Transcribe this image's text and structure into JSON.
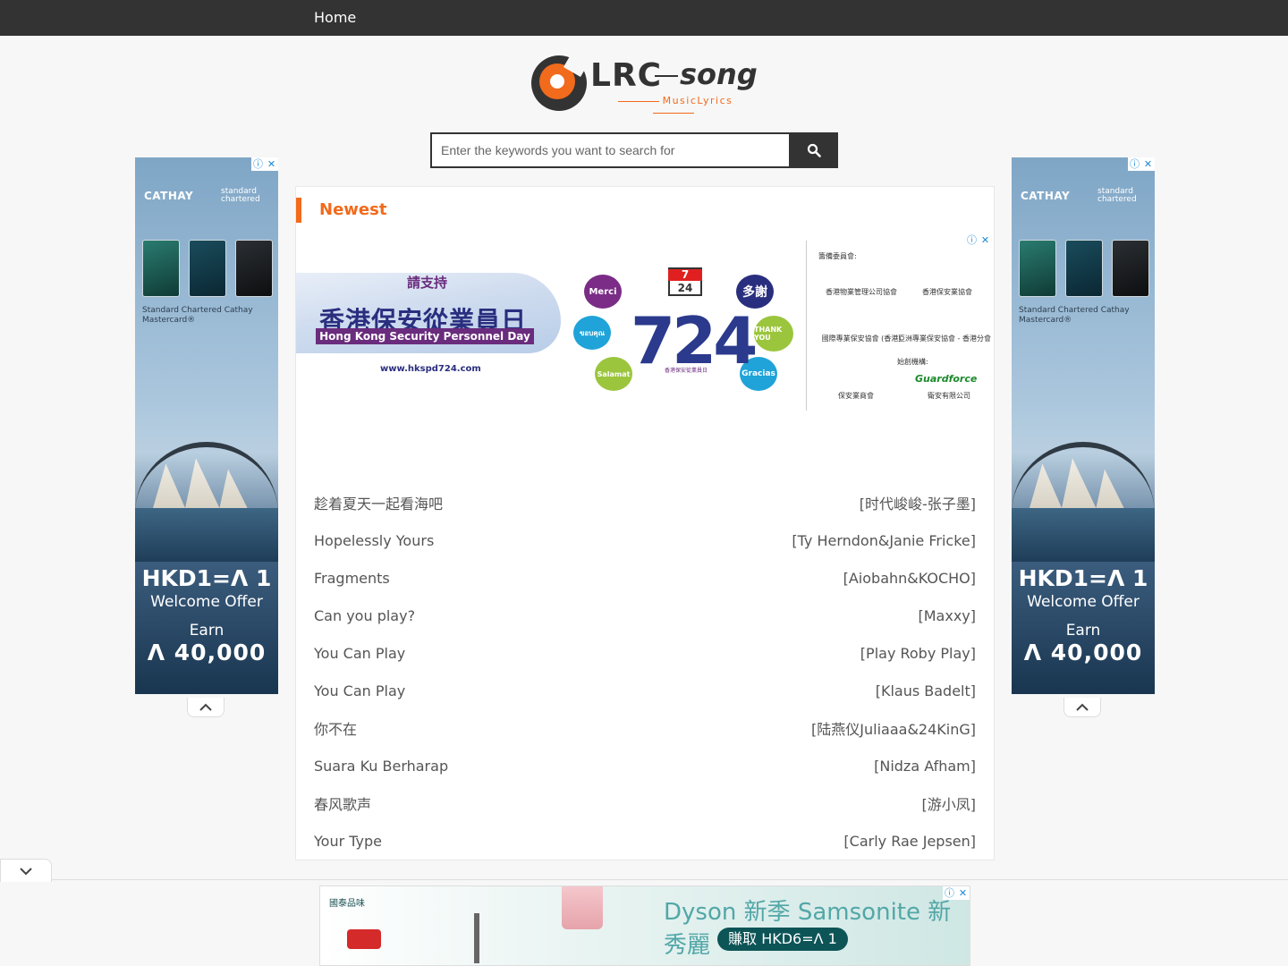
{
  "nav": {
    "home_label": "Home"
  },
  "logo": {
    "main": "LRC",
    "script": "song",
    "tagline": "MusicLyrics"
  },
  "search": {
    "placeholder": "Enter the keywords you want to search for",
    "value": ""
  },
  "side_ad": {
    "brand": "CATHAY",
    "partner": "standard chartered",
    "card_name": "Standard Chartered Cathay Mastercard®",
    "headline": "HKD1=Ʌ 1",
    "offer": "Welcome Offer",
    "earn": "Earn",
    "points": "Ʌ 40,000"
  },
  "section": {
    "title": "Newest"
  },
  "mid_ad": {
    "support": "請支持",
    "event_zh": "香港保安從業員日",
    "event_en": "Hong Kong Security Personnel Day",
    "site": "www.hkspd724.com",
    "cal_month": "7",
    "cal_day": "24",
    "bubbles": [
      "Merci",
      "多謝",
      "ขอบคุณ",
      "THANK YOU",
      "Salamat",
      "Gracias"
    ],
    "big": "724",
    "big_caption": "香港保安從業員日",
    "org_heading": "籌備委員會:",
    "orgs": [
      "香港物業管理公司協會",
      "香港保安業協會",
      "國際專業保安協會 (香港)",
      "亞洲專業保安協會 - 香港分會"
    ],
    "founder_heading": "始創機構:",
    "founders": [
      "保安業商會",
      "Guardforce",
      "衛安有限公司"
    ]
  },
  "songs": [
    {
      "title": "趁着夏天一起看海吧",
      "artist": "[时代峻峻-张子墨]"
    },
    {
      "title": "Hopelessly Yours",
      "artist": "[Ty Herndon&Janie Fricke]"
    },
    {
      "title": "Fragments",
      "artist": "[Aiobahn&KOCHO]"
    },
    {
      "title": "Can you play?",
      "artist": "[Maxxy]"
    },
    {
      "title": "You Can Play",
      "artist": "[Play Roby Play]"
    },
    {
      "title": "You Can Play",
      "artist": "[Klaus Badelt]"
    },
    {
      "title": "你不在",
      "artist": "[陆燕仪Juliaaa&24KinG]"
    },
    {
      "title": "Suara Ku Berharap",
      "artist": "[Nidza Afham]"
    },
    {
      "title": "春风歌声",
      "artist": "[游小凤]"
    },
    {
      "title": "Your Type",
      "artist": "[Carly Rae Jepsen]"
    }
  ],
  "bottom_ad": {
    "brand": "國泰品味",
    "title": "Dyson 新季 Samsonite 新秀麗",
    "cta": "賺取 HKD6=Ʌ 1"
  },
  "icons": {
    "search": "search-icon",
    "ad_info": "ⓘ",
    "ad_close": "✕"
  },
  "colors": {
    "accent": "#f26a1b",
    "nav": "#333333"
  }
}
